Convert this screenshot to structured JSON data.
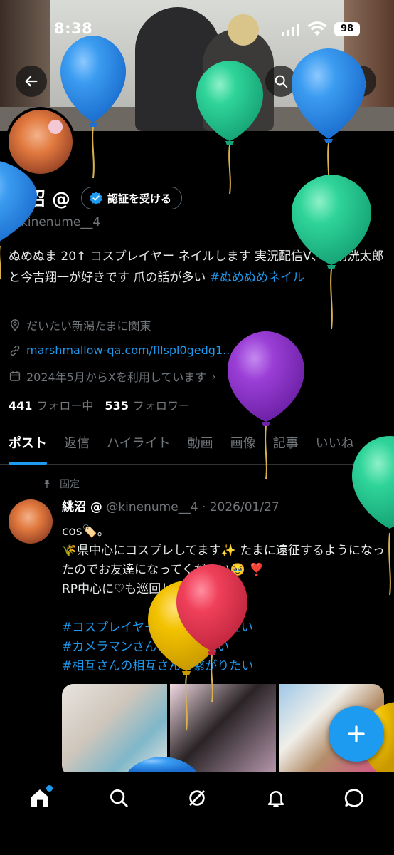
{
  "status": {
    "time": "8:38",
    "battery": "98"
  },
  "profile": {
    "name": "絩沼 @",
    "verify_label": "認証を受ける",
    "handle": "@kinenume__4",
    "bio_text": "ぬめぬま 20↑ コスプレイヤー ネイルします 実況配信V、諏訪洸太郎と今吉翔一が好きです 爪の話が多い ",
    "bio_tag": "#ぬめぬめネイル",
    "location": "だいたい新潟たまに関東",
    "link": "marshmallow-qa.com/fllspl0gedg1...",
    "joined": "2024年5月からXを利用しています",
    "following_count": "441",
    "following_label": "フォロー中",
    "followers_count": "535",
    "followers_label": "フォロワー"
  },
  "tabs": [
    "ポスト",
    "返信",
    "ハイライト",
    "動画",
    "画像",
    "記事",
    "いいね"
  ],
  "post": {
    "pinned_label": "固定",
    "author": "絩沼 @",
    "meta": " @kinenume__4 · 2026/01/27",
    "line1": "cos🏷️。",
    "line2": "🌾県中心にコスプレしてます✨ たまに遠征するようになったのでお友達になってください🥹 ❣️",
    "line3": "RP中心に♡も巡回します😳",
    "tag1": "#コスプレイヤーさんと繋がりたい",
    "tag2": "#カメラマンさんと繋がりたい",
    "tag3": "#相互さんの相互さんと繋がりたい"
  },
  "colors": {
    "accent": "#1d9bf0",
    "balloon_blue": "#3b9cf0",
    "balloon_green": "#2fd49a",
    "balloon_purple": "#9b3fd6",
    "balloon_yellow": "#f2c200",
    "balloon_red": "#f0405a"
  },
  "icons": {
    "back": "arrow-left-icon",
    "grok": "grok-icon",
    "search": "search-icon",
    "edit": "pencil-icon",
    "share": "share-icon",
    "compose": "plus-icon",
    "nav": [
      "home-icon",
      "search-icon",
      "grok-icon",
      "bell-icon",
      "message-icon"
    ]
  }
}
